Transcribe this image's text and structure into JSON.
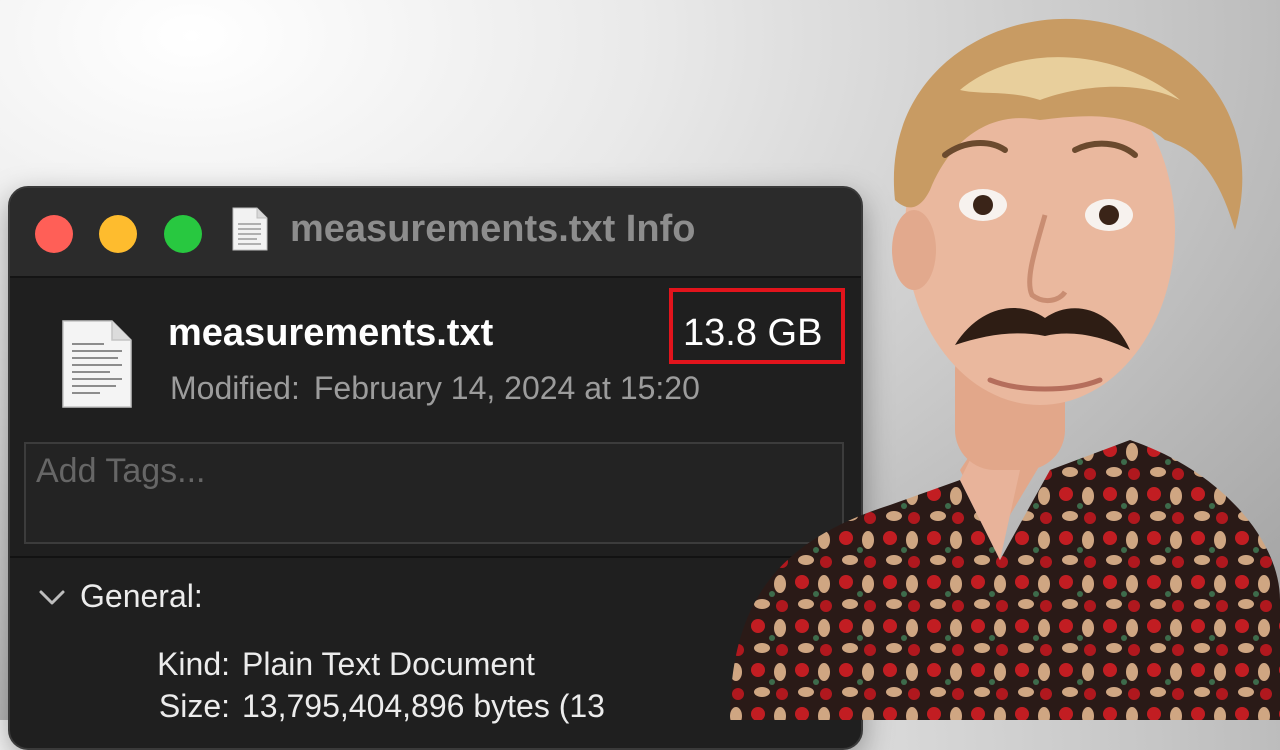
{
  "window": {
    "title": "measurements.txt Info",
    "file_name": "measurements.txt",
    "file_size": "13.8 GB",
    "modified_label": "Modified:",
    "modified_value": "February 14, 2024 at 15:20",
    "tags_placeholder": "Add Tags...",
    "general": {
      "label": "General:",
      "kind_label": "Kind:",
      "kind_value": "Plain Text Document",
      "size_label": "Size:",
      "size_value": "13,795,404,896 bytes (13"
    }
  },
  "icons": {
    "close": "close-button-icon",
    "minimize": "minimize-button-icon",
    "zoom": "zoom-button-icon",
    "document": "text-document-icon",
    "disclosure": "chevron-down-icon"
  },
  "colors": {
    "highlight": "#e2141c",
    "traffic_close": "#ff5f57",
    "traffic_minimize": "#febc2e",
    "traffic_zoom": "#28c840"
  }
}
